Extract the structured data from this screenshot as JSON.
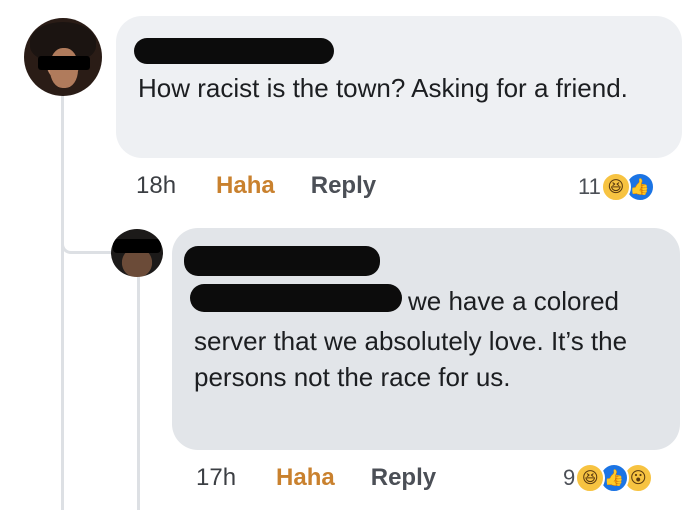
{
  "main_comment": {
    "text": "How racist is the town? Asking for a friend.",
    "time": "18h",
    "haha_label": "Haha",
    "reply_label": "Reply",
    "reaction_count": "11",
    "reaction_icons": [
      "haha-icon",
      "like-icon"
    ]
  },
  "reply_comment": {
    "text_first_line": "we have a colored",
    "text_rest": "server that we absolutely love. It’s the persons not the race for us.",
    "time": "17h",
    "haha_label": "Haha",
    "reply_label": "Reply",
    "reaction_count": "9",
    "reaction_icons": [
      "haha-icon",
      "like-icon",
      "wow-icon"
    ]
  },
  "colors": {
    "haha_accent": "#c9812e",
    "like_blue": "#1b74e4",
    "bubble_gray": "#eef0f3"
  }
}
